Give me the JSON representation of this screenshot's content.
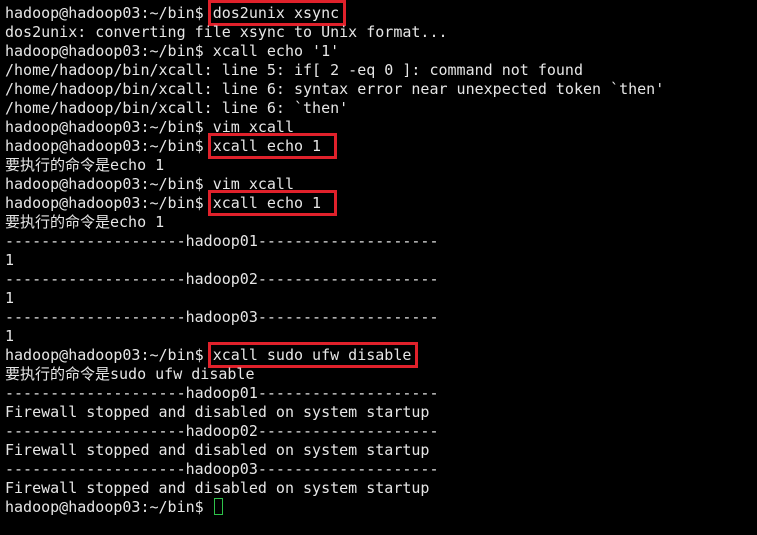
{
  "terminal": {
    "prompt": "hadoop@hadoop03:~/bin$ ",
    "lines": [
      {
        "type": "cmd",
        "text": "dos2unix xsync",
        "highlight": true
      },
      {
        "type": "out",
        "text": "dos2unix: converting file xsync to Unix format..."
      },
      {
        "type": "cmd",
        "text": "xcall echo '1'",
        "highlight": false
      },
      {
        "type": "out",
        "text": "/home/hadoop/bin/xcall: line 5: if[ 2 -eq 0 ]: command not found"
      },
      {
        "type": "out",
        "text": "/home/hadoop/bin/xcall: line 6: syntax error near unexpected token `then'"
      },
      {
        "type": "out",
        "text": "/home/hadoop/bin/xcall: line 6: `then'"
      },
      {
        "type": "cmd",
        "text": "vim xcall",
        "highlight": false
      },
      {
        "type": "cmd",
        "text": "xcall echo 1 ",
        "highlight": true
      },
      {
        "type": "out",
        "text": "要执行的命令是echo 1"
      },
      {
        "type": "cmd",
        "text": "vim xcall",
        "highlight": false
      },
      {
        "type": "cmd",
        "text": "xcall echo 1 ",
        "highlight": true
      },
      {
        "type": "out",
        "text": "要执行的命令是echo 1"
      },
      {
        "type": "out",
        "text": "--------------------hadoop01--------------------"
      },
      {
        "type": "out",
        "text": "1"
      },
      {
        "type": "out",
        "text": "--------------------hadoop02--------------------"
      },
      {
        "type": "out",
        "text": "1"
      },
      {
        "type": "out",
        "text": "--------------------hadoop03--------------------"
      },
      {
        "type": "out",
        "text": "1"
      },
      {
        "type": "cmd",
        "text": "xcall sudo ufw disable",
        "highlight": true
      },
      {
        "type": "out",
        "text": "要执行的命令是sudo ufw disable"
      },
      {
        "type": "out",
        "text": "--------------------hadoop01--------------------"
      },
      {
        "type": "out",
        "text": "Firewall stopped and disabled on system startup"
      },
      {
        "type": "out",
        "text": "--------------------hadoop02--------------------"
      },
      {
        "type": "out",
        "text": "Firewall stopped and disabled on system startup"
      },
      {
        "type": "out",
        "text": "--------------------hadoop03--------------------"
      },
      {
        "type": "out",
        "text": "Firewall stopped and disabled on system startup"
      },
      {
        "type": "input",
        "text": ""
      }
    ]
  },
  "colors": {
    "background": "#000000",
    "text": "#e6e6e6",
    "highlight_box": "#e0212b",
    "cursor": "#2ec24a"
  }
}
